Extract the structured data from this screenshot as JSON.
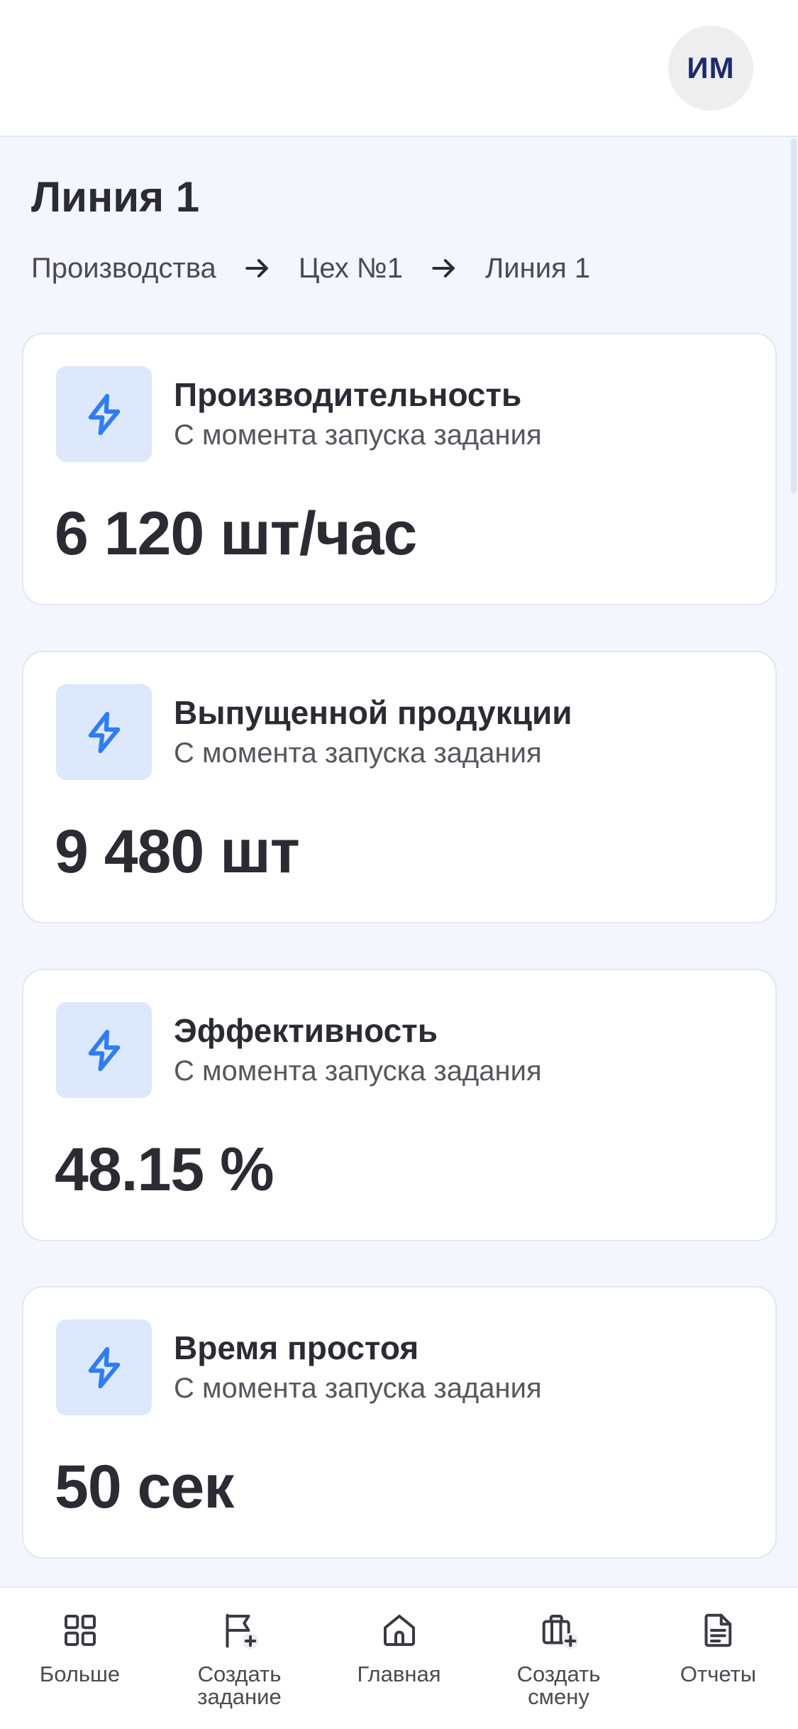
{
  "header": {
    "avatar_initials": "ИМ"
  },
  "page": {
    "title": "Линия 1",
    "breadcrumb": [
      "Производства",
      "Цех №1",
      "Линия 1"
    ]
  },
  "colors": {
    "accent": "#2f7df2",
    "icon_bg": "#dde8fd",
    "page_bg": "#f3f6fd",
    "text": "#2b2b33"
  },
  "cards": [
    {
      "icon": "lightning-icon",
      "title": "Производительность",
      "subtitle": "С момента запуска задания",
      "value": "6 120 шт/час"
    },
    {
      "icon": "lightning-icon",
      "title": "Выпущенной продукции",
      "subtitle": "С момента запуска задания",
      "value": "9 480 шт"
    },
    {
      "icon": "lightning-icon",
      "title": "Эффективность",
      "subtitle": "С момента запуска задания",
      "value": "48.15 %"
    },
    {
      "icon": "lightning-icon",
      "title": "Время простоя",
      "subtitle": "С момента запуска задания",
      "value": "50 сек"
    }
  ],
  "nav": [
    {
      "icon": "grid-icon",
      "label": "Больше"
    },
    {
      "icon": "flag-plus-icon",
      "label": "Создать задание"
    },
    {
      "icon": "home-icon",
      "label": "Главная"
    },
    {
      "icon": "briefcase-plus-icon",
      "label": "Создать смену"
    },
    {
      "icon": "document-icon",
      "label": "Отчеты"
    }
  ]
}
